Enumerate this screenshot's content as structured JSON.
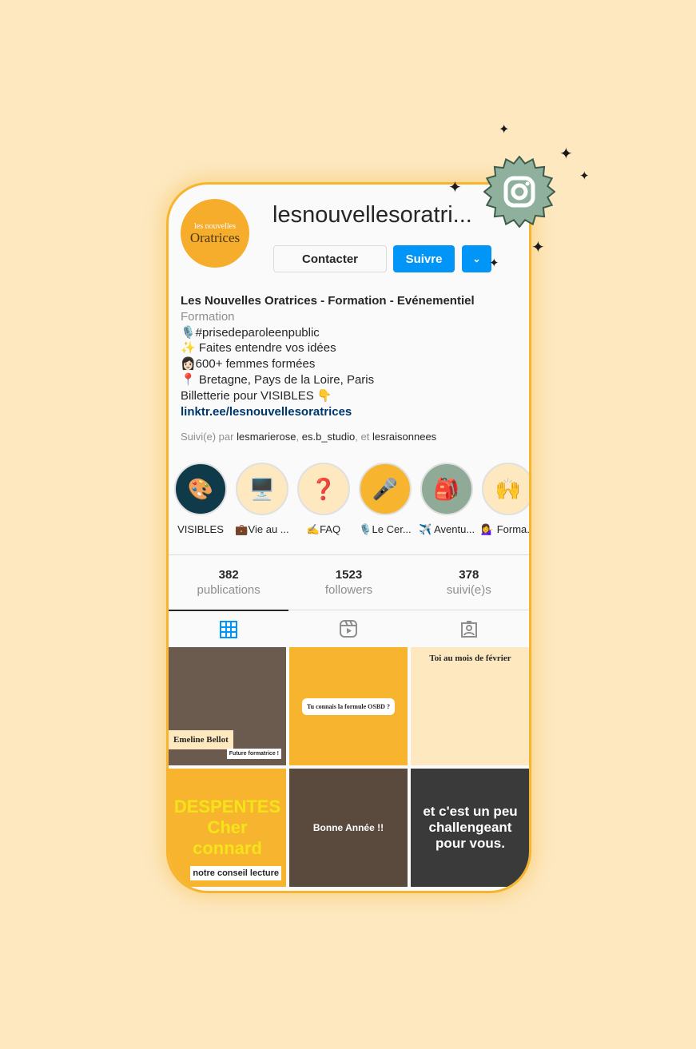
{
  "profile": {
    "username": "lesnouvellesoratri...",
    "avatar_text_top": "les nouvelles",
    "avatar_text": "Oratrices"
  },
  "actions": {
    "contact": "Contacter",
    "follow": "Suivre",
    "dropdown": "⌄"
  },
  "bio": {
    "name": "Les Nouvelles Oratrices - Formation - Evénementiel",
    "category": "Formation",
    "lines": [
      "🎙️#prisedeparoleenpublic",
      "✨ Faites entendre vos idées",
      "👩🏻600+ femmes formées",
      "📍 Bretagne, Pays de la Loire, Paris",
      "Billetterie pour VISIBLES 👇"
    ],
    "link": "linktr.ee/lesnouvellesoratrices"
  },
  "followed_by": {
    "prefix": "Suivi(e) par",
    "users": [
      "lesmarierose",
      "es.b_studio"
    ],
    "sep": ", ",
    "and": ", et",
    "last": "lesraisonnees"
  },
  "highlights": [
    {
      "label": "VISIBLES",
      "color": "#0f3a4a",
      "icon": "🎨"
    },
    {
      "label": "💼Vie au ...",
      "color": "#fde8c0",
      "icon": "🖥️"
    },
    {
      "label": "✍️FAQ",
      "color": "#fde8c0",
      "icon": "❓"
    },
    {
      "label": "🎙️Le Cer...",
      "color": "#f7b52f",
      "icon": "🎤"
    },
    {
      "label": "✈️ Aventu...",
      "color": "#8fab98",
      "icon": "🎒"
    },
    {
      "label": "💁‍♀️ Forma...",
      "color": "#fde8c0",
      "icon": "🙌"
    }
  ],
  "stats": [
    {
      "value": "382",
      "label": "publications"
    },
    {
      "value": "1523",
      "label": "followers"
    },
    {
      "value": "378",
      "label": "suivi(e)s"
    }
  ],
  "tabs": [
    {
      "icon": "grid-icon",
      "active": true
    },
    {
      "icon": "reels-icon"
    },
    {
      "icon": "tagged-icon"
    }
  ],
  "posts": [
    {
      "text": "Emeline Bellot",
      "sub": "Future formatrice !",
      "bg": "#6b5a4e"
    },
    {
      "text": "Tu connais la formule OSBD ?",
      "bg": "#f7b52f"
    },
    {
      "text": "Toi au mois de février",
      "bg": "#fde8c0"
    },
    {
      "text": "DESPENTES Cher connard",
      "sub": "notre conseil lecture",
      "bg": "#f7b52f"
    },
    {
      "text": "Bonne Année !!",
      "bg": "#5a4a3e"
    },
    {
      "text": "et c'est un peu challengeant pour vous.",
      "bg": "#3a3a3a"
    }
  ],
  "colors": {
    "background": "#fde8c0",
    "frame": "#f7b52f",
    "accent": "#0095f6",
    "badge": "#8fb09d"
  }
}
